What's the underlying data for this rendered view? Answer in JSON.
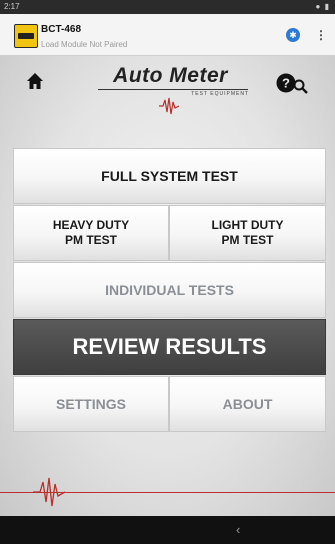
{
  "statusbar": {
    "time": "2:17",
    "icons": "● ▮"
  },
  "notification": {
    "app_icon": "battery-tester-app-icon",
    "title": "BCT-468",
    "subtitle": "Load Module Not Paired",
    "bluetooth_icon": "bluetooth-icon",
    "menu_icon": "overflow-menu-icon"
  },
  "header": {
    "home_icon": "home-icon",
    "logo_text": "Auto Meter",
    "logo_sub": "TEST EQUIPMENT",
    "help_icon": "help-search-icon"
  },
  "buttons": {
    "full_system_test": "FULL SYSTEM TEST",
    "heavy_duty_line1": "HEAVY DUTY",
    "heavy_duty_line2": "PM TEST",
    "light_duty_line1": "LIGHT DUTY",
    "light_duty_line2": "PM TEST",
    "individual_tests": "INDIVIDUAL TESTS",
    "review_results": "REVIEW RESULTS",
    "settings": "SETTINGS",
    "about": "ABOUT"
  },
  "navbar": {
    "back_glyph": "‹"
  },
  "colors": {
    "accent_red": "#b8302a",
    "review_bg": "#4a4a4a",
    "disabled_text": "#8a8f96",
    "bluetooth": "#2d79d6"
  }
}
